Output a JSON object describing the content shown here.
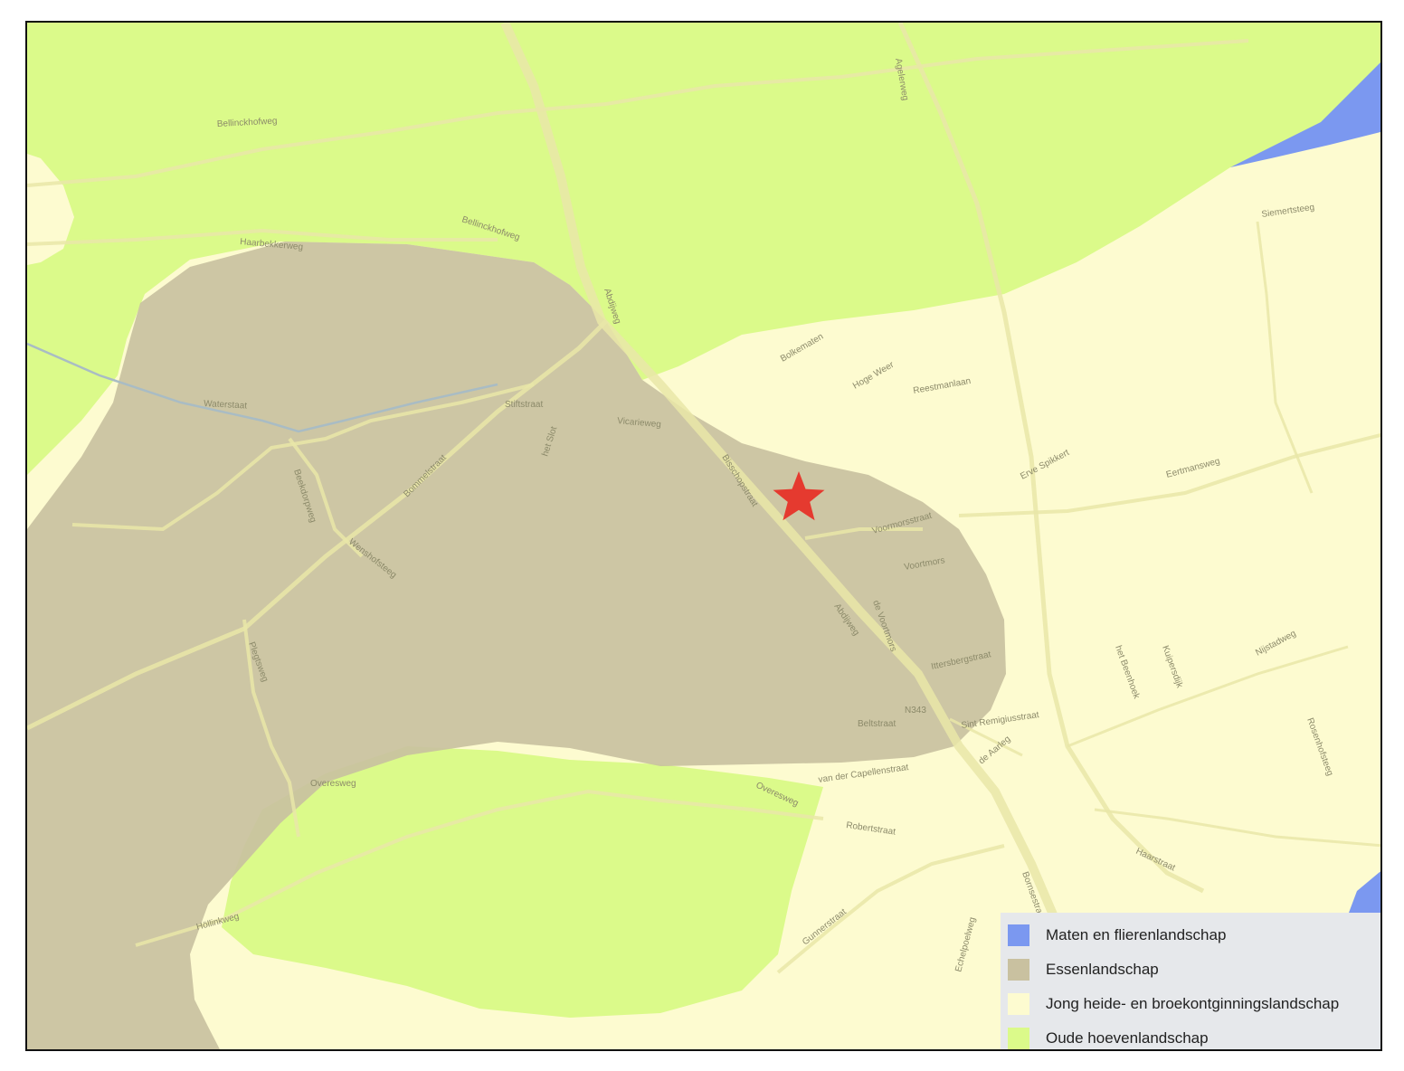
{
  "map": {
    "landscape_types": [
      {
        "id": "maten",
        "color": "#7b98f0"
      },
      {
        "id": "essen",
        "color": "#c9c1a0"
      },
      {
        "id": "jong",
        "color": "#fdfbd0"
      },
      {
        "id": "oude",
        "color": "#dbfa8a"
      }
    ],
    "marker": {
      "icon": "star-icon",
      "color": "#e53a2f"
    },
    "street_labels": [
      "Bellinckhofweg",
      "Bellinckhofweg",
      "Haarbekkerweg",
      "Abdijweg",
      "Agelerweg",
      "Siemertsteeg",
      "Bolkematen",
      "Hoge Weer",
      "Reestmanlaan",
      "Stiftstraat",
      "Vicarieweg",
      "het Slot",
      "Bisschopstraat",
      "Voormorsstraat",
      "Voortmors",
      "de Voortmors",
      "Abdijweg",
      "Ittersbergstraat",
      "N343",
      "Beltstraat",
      "Sint Remigiusstraat",
      "Erve Spikkert",
      "Eertmansweg",
      "Bommelstraat",
      "Beekdorpweg",
      "Wenshofsteeg",
      "Plegtsweg",
      "Overesweg",
      "Overesweg",
      "van der Capellenstraat",
      "Robertstraat",
      "de Aarleg",
      "Haarstraat",
      "Rosenhofsteeg",
      "Nijstadweg",
      "Bornsestraat",
      "Kuipersdijk",
      "het Beenhoek",
      "Gunnerstraat",
      "Höllinkweg",
      "Echelpoelweg",
      "Waterstaat"
    ]
  },
  "legend": {
    "items": [
      {
        "label": "Maten en flierenlandschap",
        "color": "#7b98f0"
      },
      {
        "label": "Essenlandschap",
        "color": "#c9c1a0"
      },
      {
        "label": "Jong heide- en broekontginningslandschap",
        "color": "#fdfbd0"
      },
      {
        "label": "Oude hoevenlandschap",
        "color": "#dbfa8a"
      }
    ]
  }
}
